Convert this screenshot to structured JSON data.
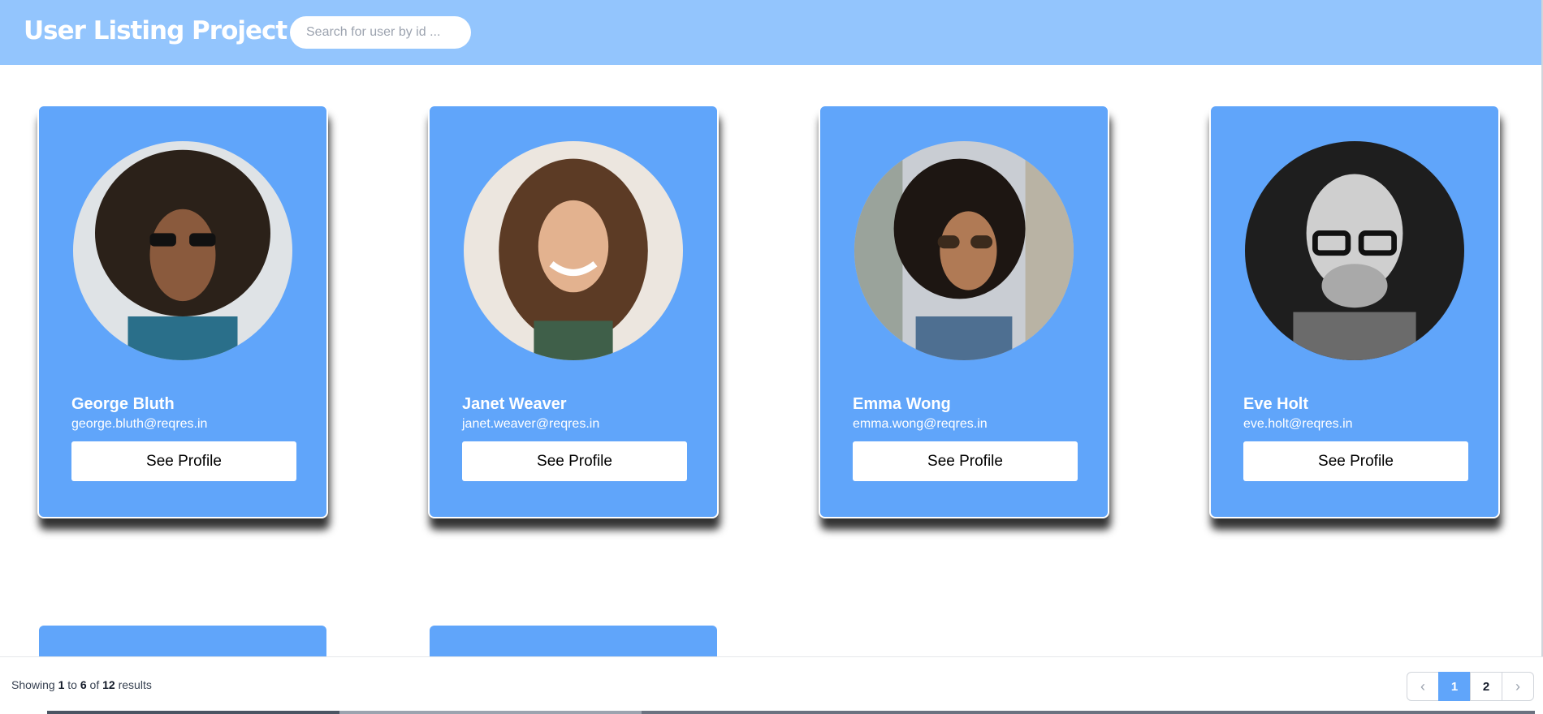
{
  "header": {
    "title": "User Listing Project",
    "search_placeholder": "Search for user by id ..."
  },
  "colors": {
    "header_bg": "#93c5fd",
    "card_bg": "#60a5fa",
    "accent": "#60a5fa"
  },
  "users": [
    {
      "name": "George Bluth",
      "email": "george.bluth@reqres.in",
      "button": "See Profile",
      "avatar": "avatar-photo"
    },
    {
      "name": "Janet Weaver",
      "email": "janet.weaver@reqres.in",
      "button": "See Profile",
      "avatar": "avatar-photo"
    },
    {
      "name": "Emma Wong",
      "email": "emma.wong@reqres.in",
      "button": "See Profile",
      "avatar": "avatar-photo"
    },
    {
      "name": "Eve Holt",
      "email": "eve.holt@reqres.in",
      "button": "See Profile",
      "avatar": "avatar-photo"
    }
  ],
  "footer": {
    "showing": "Showing",
    "from": "1",
    "to_word": "to",
    "to": "6",
    "of_word": "of",
    "total": "12",
    "results_word": "results",
    "pages": [
      "1",
      "2"
    ],
    "current_page": "1",
    "prev_icon": "chevron-left-icon",
    "next_icon": "chevron-right-icon"
  }
}
